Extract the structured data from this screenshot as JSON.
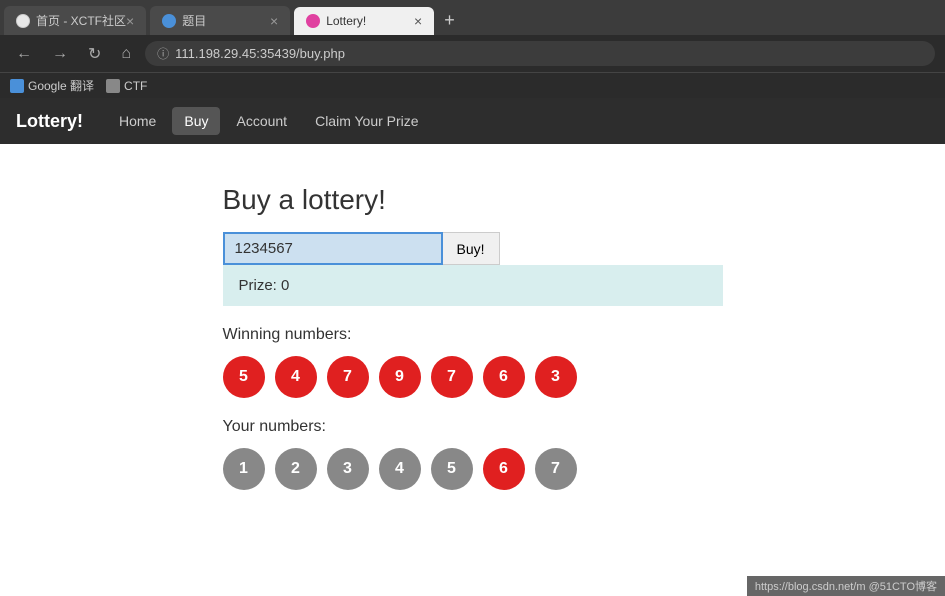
{
  "browser": {
    "tabs": [
      {
        "id": "tab1",
        "title": "首页 - XCTF社区",
        "active": false,
        "favicon_color": "#e8e8e8"
      },
      {
        "id": "tab2",
        "title": "题目",
        "active": false,
        "favicon_color": "#4a90d9"
      },
      {
        "id": "tab3",
        "title": "Lottery!",
        "active": true,
        "favicon_color": "#e040a0"
      }
    ],
    "url": "111.198.29.45:35439/buy.php",
    "bookmarks": [
      {
        "label": "Google 翻译",
        "type": "google"
      },
      {
        "label": "CTF",
        "type": "ctf"
      }
    ]
  },
  "navbar": {
    "logo": "Lottery!",
    "links": [
      {
        "label": "Home",
        "active": false
      },
      {
        "label": "Buy",
        "active": true
      },
      {
        "label": "Account",
        "active": false
      },
      {
        "label": "Claim Your Prize",
        "active": false
      }
    ]
  },
  "main": {
    "title": "Buy a lottery!",
    "input_value": "1234567",
    "buy_button_label": "Buy!",
    "prize_label": "Prize: 0",
    "winning_label": "Winning numbers:",
    "winning_numbers": [
      {
        "value": "5",
        "type": "red"
      },
      {
        "value": "4",
        "type": "red"
      },
      {
        "value": "7",
        "type": "red"
      },
      {
        "value": "9",
        "type": "red"
      },
      {
        "value": "7",
        "type": "red"
      },
      {
        "value": "6",
        "type": "red"
      },
      {
        "value": "3",
        "type": "red"
      }
    ],
    "your_label": "Your numbers:",
    "your_numbers": [
      {
        "value": "1",
        "type": "gray"
      },
      {
        "value": "2",
        "type": "gray"
      },
      {
        "value": "3",
        "type": "gray"
      },
      {
        "value": "4",
        "type": "gray"
      },
      {
        "value": "5",
        "type": "gray"
      },
      {
        "value": "6",
        "type": "match"
      },
      {
        "value": "7",
        "type": "gray"
      }
    ]
  },
  "status_bar": {
    "text": "https://blog.csdn.net/m  @51CTO博客"
  }
}
